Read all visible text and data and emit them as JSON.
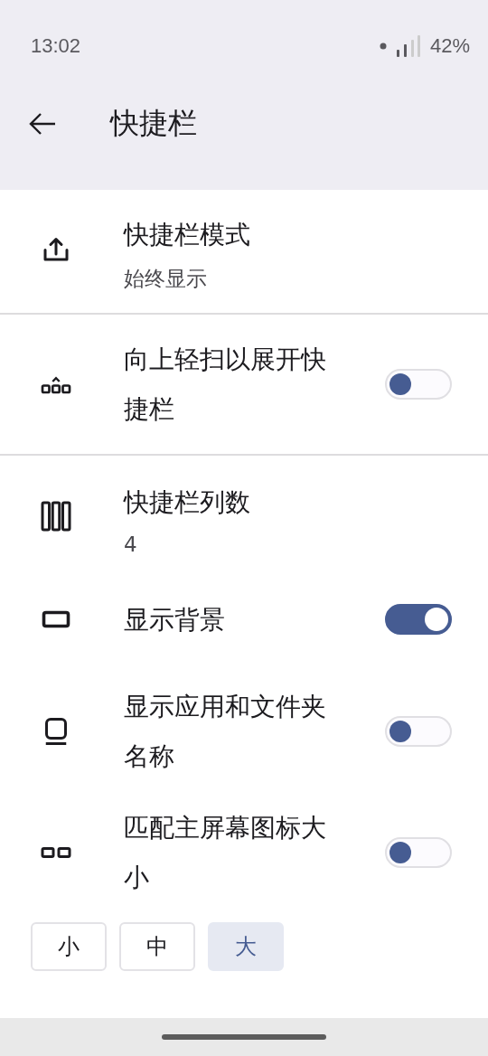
{
  "status_bar": {
    "time": "13:02",
    "battery": "42%"
  },
  "header": {
    "title": "快捷栏"
  },
  "sections": [
    {
      "items": [
        {
          "kind": "select",
          "title": "快捷栏模式",
          "summary": "始终显示"
        }
      ]
    },
    {
      "items": [
        {
          "kind": "toggle",
          "title": "向上轻扫以展开快捷栏",
          "on": false
        }
      ]
    },
    {
      "items": [
        {
          "kind": "select",
          "title": "快捷栏列数",
          "summary": "4"
        },
        {
          "kind": "toggle",
          "title": "显示背景",
          "on": true
        },
        {
          "kind": "toggle",
          "title": "显示应用和文件夹名称",
          "on": false
        },
        {
          "kind": "toggle",
          "title": "匹配主屏幕图标大小",
          "on": false
        }
      ]
    }
  ],
  "size_options": [
    {
      "label": "小",
      "selected": false
    },
    {
      "label": "中",
      "selected": false
    },
    {
      "label": "大",
      "selected": true
    }
  ]
}
